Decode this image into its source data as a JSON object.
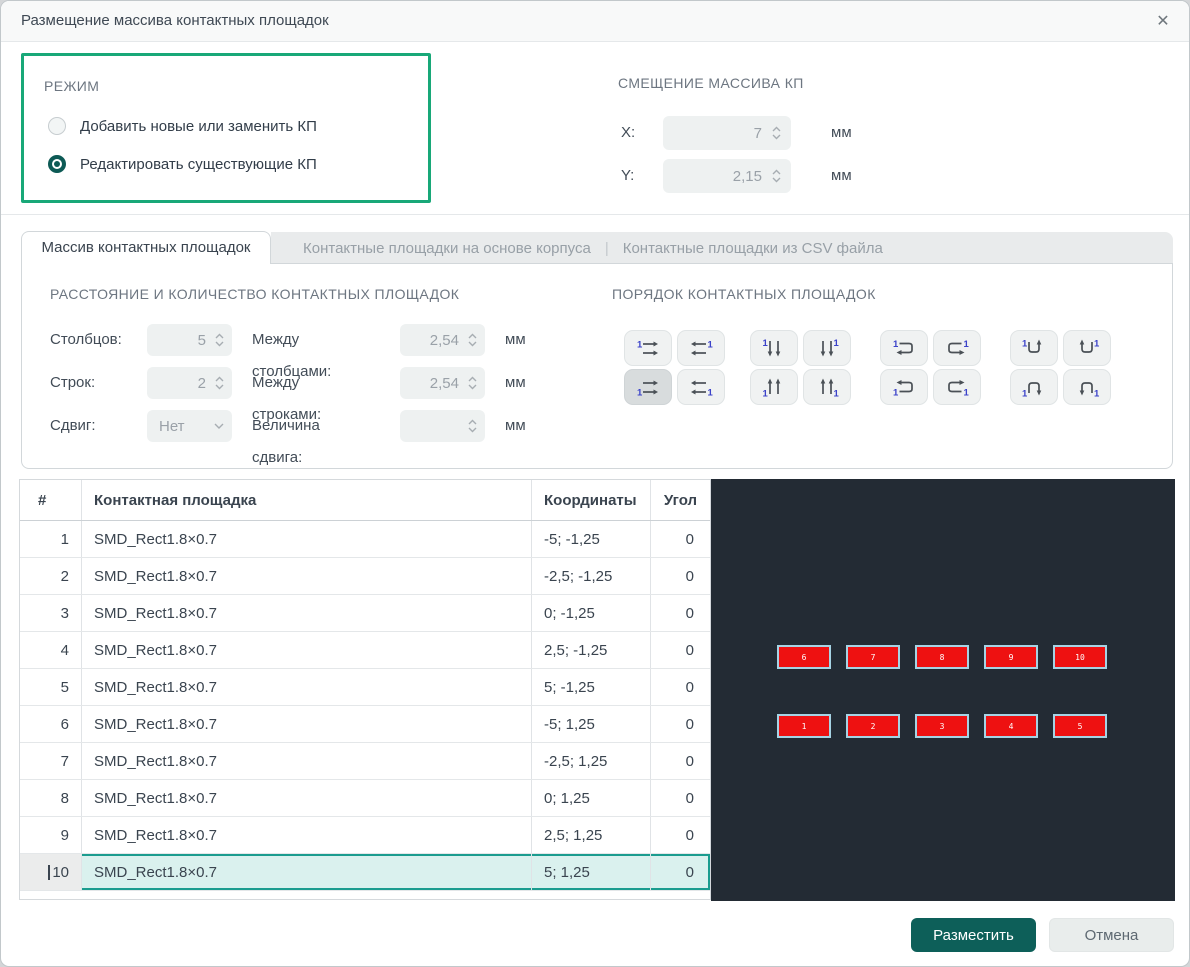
{
  "dialog": {
    "title": "Размещение массива контактных площадок",
    "close_icon": "✕"
  },
  "colors": {
    "accent_highlight_green": "#18a878",
    "primary_button_teal": "#0d5f59",
    "selected_radio_teal": "#0d5a55",
    "row_selection_bg": "#daf1ee",
    "row_selection_border": "#1b9c8f",
    "preview_background": "#232b34",
    "pad_fill_red": "#ee1111",
    "pad_border_blue": "#a6d3e4",
    "icon_digit_blue": "#3c43c9"
  },
  "mode": {
    "label": "РЕЖИМ",
    "options": [
      {
        "label": "Добавить новые или заменить КП",
        "selected": false
      },
      {
        "label": "Редактировать существующие КП",
        "selected": true
      }
    ]
  },
  "offset": {
    "label": "СМЕЩЕНИЕ МАССИВА КП",
    "rows": [
      {
        "label": "X:",
        "value": "7",
        "unit": "мм"
      },
      {
        "label": "Y:",
        "value": "2,15",
        "unit": "мм"
      }
    ]
  },
  "tabs": {
    "separator": "|",
    "items": [
      {
        "label": "Массив контактных площадок",
        "active": true
      },
      {
        "label": "Контактные площадки на основе корпуса",
        "active": false
      },
      {
        "label": "Контактные площадки из CSV файла",
        "active": false
      }
    ]
  },
  "spacing": {
    "title": "РАССТОЯНИЕ И КОЛИЧЕСТВО КОНТАКТНЫХ ПЛОЩАДОК",
    "rows": [
      {
        "label1": "Столбцов:",
        "value1": "5",
        "label2": "Между столбцами:",
        "value2": "2,54",
        "unit": "мм"
      },
      {
        "label1": "Строк:",
        "value1": "2",
        "label2": "Между строками:",
        "value2": "2,54",
        "unit": "мм"
      },
      {
        "label1": "Сдвиг:",
        "value1": "Нет",
        "label2": "Величина сдвига:",
        "value2": "",
        "unit": "мм"
      }
    ]
  },
  "order": {
    "title": "ПОРЯДОК КОНТАКТНЫХ ПЛОЩАДОК",
    "buttons": [
      {
        "icon": "order-row-ltr-start-top-icon",
        "selected": false
      },
      {
        "icon": "order-row-rtl-start-top-icon",
        "selected": false
      },
      {
        "icon": "order-row-ltr-start-bottom-icon",
        "selected": true
      },
      {
        "icon": "order-row-rtl-start-bottom-icon",
        "selected": false
      },
      {
        "icon": "order-col-down-start-left-icon",
        "selected": false
      },
      {
        "icon": "order-col-down-start-right-icon",
        "selected": false
      },
      {
        "icon": "order-col-up-start-left-icon",
        "selected": false
      },
      {
        "icon": "order-col-up-start-right-icon",
        "selected": false
      },
      {
        "icon": "order-snake-row-start-top-left-icon",
        "selected": false
      },
      {
        "icon": "order-snake-row-start-top-right-icon",
        "selected": false
      },
      {
        "icon": "order-snake-row-start-bottom-left-icon",
        "selected": false
      },
      {
        "icon": "order-snake-row-start-bottom-right-icon",
        "selected": false
      },
      {
        "icon": "order-snake-col-start-top-left-icon",
        "selected": false
      },
      {
        "icon": "order-snake-col-start-top-right-icon",
        "selected": false
      },
      {
        "icon": "order-snake-col-start-bottom-left-icon",
        "selected": false
      },
      {
        "icon": "order-snake-col-start-bottom-right-icon",
        "selected": false
      }
    ]
  },
  "table": {
    "columns": [
      "#",
      "Контактная площадка",
      "Координаты",
      "Угол"
    ],
    "rows": [
      {
        "num": "1",
        "pad": "SMD_Rect1.8×0.7",
        "coords": "-5; -1,25",
        "angle": "0",
        "selected": false
      },
      {
        "num": "2",
        "pad": "SMD_Rect1.8×0.7",
        "coords": "-2,5; -1,25",
        "angle": "0",
        "selected": false
      },
      {
        "num": "3",
        "pad": "SMD_Rect1.8×0.7",
        "coords": "0; -1,25",
        "angle": "0",
        "selected": false
      },
      {
        "num": "4",
        "pad": "SMD_Rect1.8×0.7",
        "coords": "2,5; -1,25",
        "angle": "0",
        "selected": false
      },
      {
        "num": "5",
        "pad": "SMD_Rect1.8×0.7",
        "coords": "5; -1,25",
        "angle": "0",
        "selected": false
      },
      {
        "num": "6",
        "pad": "SMD_Rect1.8×0.7",
        "coords": "-5; 1,25",
        "angle": "0",
        "selected": false
      },
      {
        "num": "7",
        "pad": "SMD_Rect1.8×0.7",
        "coords": "-2,5; 1,25",
        "angle": "0",
        "selected": false
      },
      {
        "num": "8",
        "pad": "SMD_Rect1.8×0.7",
        "coords": "0; 1,25",
        "angle": "0",
        "selected": false
      },
      {
        "num": "9",
        "pad": "SMD_Rect1.8×0.7",
        "coords": "2,5; 1,25",
        "angle": "0",
        "selected": false
      },
      {
        "num": "10",
        "pad": "SMD_Rect1.8×0.7",
        "coords": "5; 1,25",
        "angle": "0",
        "selected": true
      }
    ]
  },
  "preview": {
    "pads": [
      "6",
      "7",
      "8",
      "9",
      "10",
      "1",
      "2",
      "3",
      "4",
      "5"
    ]
  },
  "footer": {
    "place_label": "Разместить",
    "cancel_label": "Отмена"
  }
}
